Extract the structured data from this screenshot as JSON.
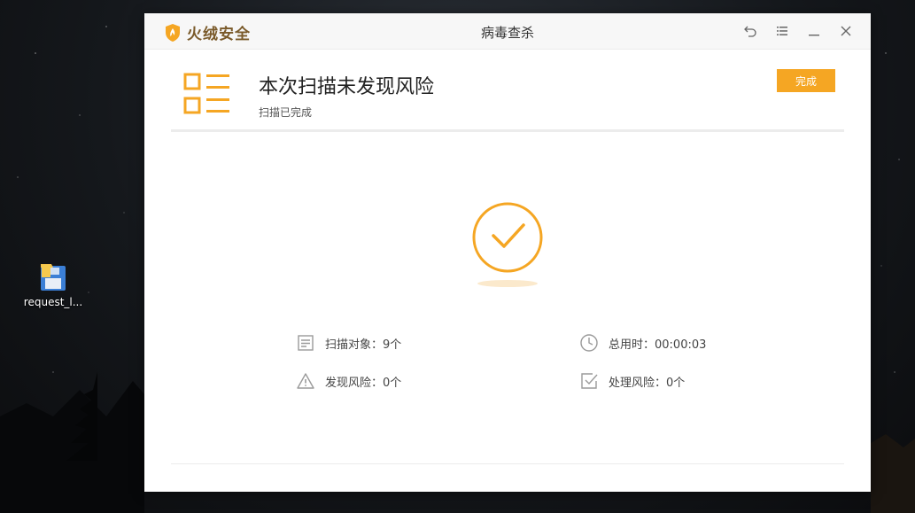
{
  "desktop": {
    "icons": [
      {
        "label": "request_l..."
      }
    ]
  },
  "window": {
    "brand_name": "火绒安全",
    "title": "病毒查杀",
    "controls": [
      "back-icon",
      "menu-icon",
      "minimize-icon",
      "close-icon"
    ]
  },
  "result": {
    "title": "本次扫描未发现风险",
    "subtitle": "扫描已完成",
    "done_label": "完成"
  },
  "stats": {
    "scan_objects": "扫描对象：9个",
    "total_time": "总用时：00:00:03",
    "risks_found": "发现风险：0个",
    "risks_handled": "处理风险：0个"
  },
  "colors": {
    "accent": "#f5a623",
    "brand": "#7a5a2a",
    "icon_gray": "#9a9a9a"
  }
}
